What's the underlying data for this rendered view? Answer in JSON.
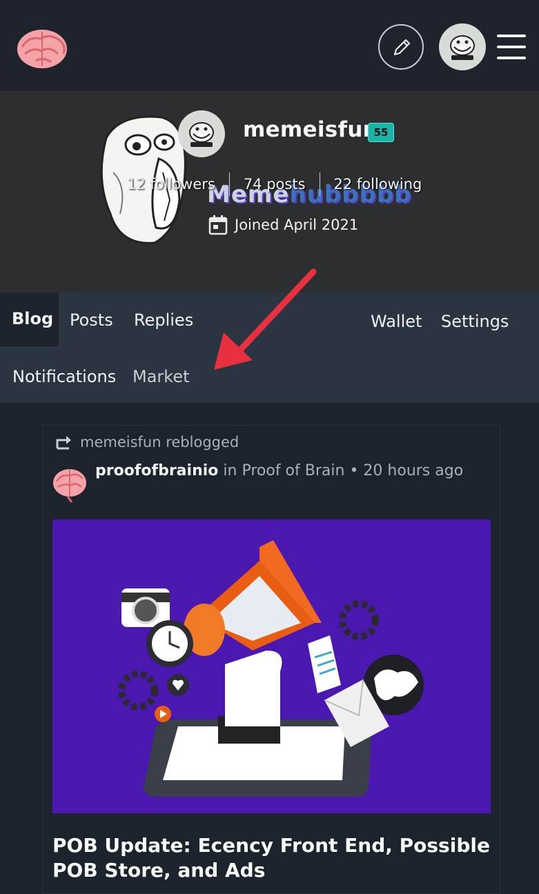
{
  "app": {
    "logo_icon": "brain-icon",
    "edit_icon": "pencil-icon",
    "menu_icon": "hamburger-menu-icon",
    "avatar_icon": "trollface-avatar"
  },
  "profile": {
    "username": "memeisfun",
    "reputation": "55",
    "brand_text_main": "Meme",
    "brand_text_rest": "hubbbbb",
    "stats": {
      "followers": "12 followers",
      "posts": "74 posts",
      "following": "22 following"
    },
    "joined": "Joined April 2021",
    "joined_icon": "calendar-icon"
  },
  "tabs": {
    "blog": "Blog",
    "posts": "Posts",
    "replies": "Replies",
    "wallet": "Wallet",
    "settings": "Settings",
    "notifications": "Notifications",
    "market": "Market",
    "active": "Blog"
  },
  "annotation": {
    "icon": "red-arrow-pointer"
  },
  "post": {
    "reblog_icon": "reblog-icon",
    "reblog_text": "memeisfun reblogged",
    "author": "proofofbrainio",
    "community_prefix": "in",
    "community": "Proof of Brain",
    "separator": "•",
    "time": "20 hours ago",
    "image_icon": "megaphone-illustration",
    "title": "POB Update: Ecency Front End, Possible POB Store, and Ads"
  },
  "colors": {
    "page_bg": "#1d232c",
    "tabbar_bg": "#2b3541",
    "cover_bg": "#2d2e30",
    "reputation_badge": "#1bb4a8",
    "arrow_red": "#e8303f",
    "post_image_bg": "#4a18b0"
  }
}
